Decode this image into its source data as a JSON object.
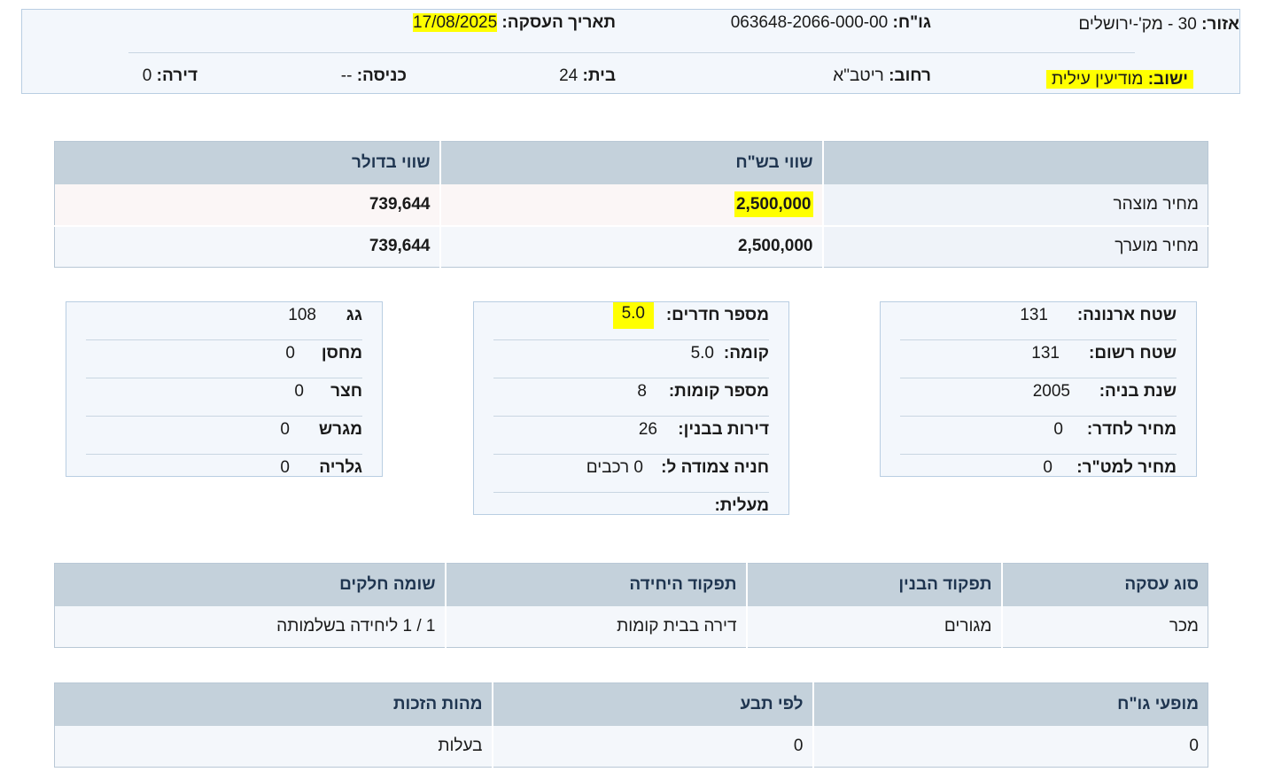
{
  "header": {
    "area_label": "אזור:",
    "area_value": "30 - מק'-ירושלים",
    "gush_label": "גו\"ח:",
    "gush_value": "063648-2066-000-00",
    "date_label": "תאריך העסקה:",
    "date_value": "17/08/2025",
    "settlement_label": "ישוב:",
    "settlement_value": "מודיעין עילית",
    "street_label": "רחוב:",
    "street_value": "ריטב\"א",
    "house_label": "בית:",
    "house_value": "24",
    "entrance_label": "כניסה:",
    "entrance_value": "--",
    "apartment_label": "דירה:",
    "apartment_value": "0"
  },
  "price_table": {
    "headers": [
      "",
      "שווי בש\"ח",
      "שווי בדולר"
    ],
    "rows": [
      {
        "label": "מחיר מוצהר",
        "ils": "2,500,000",
        "usd": "739,644"
      },
      {
        "label": "מחיר מוערך",
        "ils": "2,500,000",
        "usd": "739,644"
      }
    ]
  },
  "details_right": [
    {
      "label": "שטח ארנונה:",
      "value": "131"
    },
    {
      "label": "שטח רשום:",
      "value": "131"
    },
    {
      "label": "שנת בניה:",
      "value": "2005"
    },
    {
      "label": "מחיר לחדר:",
      "value": "0"
    },
    {
      "label": "מחיר למט\"ר:",
      "value": "0"
    }
  ],
  "details_middle": [
    {
      "label": "מספר חדרים:",
      "value": "5.0"
    },
    {
      "label": "קומה:",
      "value": "5.0"
    },
    {
      "label": "מספר קומות:",
      "value": "8"
    },
    {
      "label": "דירות בבנין:",
      "value": "26"
    },
    {
      "label": "חניה צמודה ל:",
      "value": "0 רכבים"
    },
    {
      "label": "מעלית:",
      "value": ""
    }
  ],
  "details_left": [
    {
      "label": "גג",
      "value": "108"
    },
    {
      "label": "מחסן",
      "value": "0"
    },
    {
      "label": "חצר",
      "value": "0"
    },
    {
      "label": "מגרש",
      "value": "0"
    },
    {
      "label": "גלריה",
      "value": "0"
    }
  ],
  "deal_table": {
    "headers": [
      "סוג עסקה",
      "תפקוד הבנין",
      "תפקוד היחידה",
      "שומה חלקים"
    ],
    "row": [
      "מכר",
      "מגורים",
      "דירה בבית קומות",
      "1 / 1 ליחידה בשלמותה"
    ]
  },
  "rights_table": {
    "headers": [
      "מופעי גו\"ח",
      "לפי תבע",
      "מהות הזכות"
    ],
    "row": [
      "0",
      "0",
      "בעלות"
    ]
  }
}
